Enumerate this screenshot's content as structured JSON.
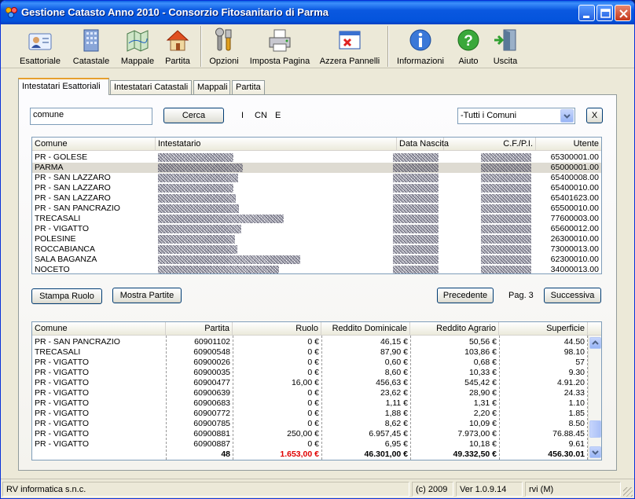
{
  "window": {
    "title": "Gestione Catasto Anno 2010 - Consorzio Fitosanitario di Parma"
  },
  "toolbar": {
    "items": [
      {
        "label": "Esattoriale",
        "icon": "id-card-icon"
      },
      {
        "label": "Catastale",
        "icon": "building-icon"
      },
      {
        "label": "Mappale",
        "icon": "map-icon"
      },
      {
        "label": "Partita",
        "icon": "house-icon"
      },
      {
        "label": "Opzioni",
        "icon": "tools-icon"
      },
      {
        "label": "Imposta Pagina",
        "icon": "printer-icon"
      },
      {
        "label": "Azzera Pannelli",
        "icon": "clear-window-icon"
      },
      {
        "label": "Informazioni",
        "icon": "info-icon"
      },
      {
        "label": "Aiuto",
        "icon": "help-icon"
      },
      {
        "label": "Uscita",
        "icon": "exit-door-icon"
      }
    ]
  },
  "tabs": [
    "Intestatari Esattoriali",
    "Intestatari Catastali",
    "Mappali",
    "Partita"
  ],
  "search": {
    "value": "comune",
    "button": "Cerca",
    "filters": [
      "I",
      "CN",
      "E"
    ],
    "comune_select": "-Tutti i Comuni",
    "clear_button": "X"
  },
  "upper_table": {
    "columns": [
      "Comune",
      "Intestatario",
      "Data Nascita",
      "C.F./P.I.",
      "Utente"
    ],
    "rows": [
      {
        "comune": "PR - GOLESE",
        "utente": "65300001.00"
      },
      {
        "comune": "PARMA",
        "utente": "65000001.00"
      },
      {
        "comune": "PR - SAN LAZZARO",
        "utente": "65400008.00"
      },
      {
        "comune": "PR - SAN LAZZARO",
        "utente": "65400010.00"
      },
      {
        "comune": "PR - SAN LAZZARO",
        "utente": "65401623.00"
      },
      {
        "comune": "PR - SAN PANCRAZIO",
        "utente": "65500010.00"
      },
      {
        "comune": "TRECASALI",
        "utente": "77600003.00"
      },
      {
        "comune": "PR - VIGATTO",
        "utente": "65600012.00"
      },
      {
        "comune": "POLESINE",
        "utente": "26300010.00"
      },
      {
        "comune": "ROCCABIANCA",
        "utente": "73000013.00"
      },
      {
        "comune": "SALA BAGANZA",
        "utente": "62300010.00"
      },
      {
        "comune": "NOCETO",
        "utente": "34000013.00"
      }
    ]
  },
  "actions": {
    "stampa_ruolo": "Stampa Ruolo",
    "mostra_partite": "Mostra Partite",
    "precedente": "Precedente",
    "page": "Pag. 3",
    "successiva": "Successiva"
  },
  "lower_table": {
    "columns": [
      "Comune",
      "Partita",
      "Ruolo",
      "Reddito Dominicale",
      "Reddito Agrario",
      "Superficie"
    ],
    "rows": [
      [
        "PR - SAN PANCRAZIO",
        "60901102",
        "0 €",
        "46,15 €",
        "50,56 €",
        "44.50"
      ],
      [
        "TRECASALI",
        "60900548",
        "0 €",
        "87,90 €",
        "103,86 €",
        "98.10"
      ],
      [
        "PR - VIGATTO",
        "60900026",
        "0 €",
        "0,60 €",
        "0,68 €",
        "57"
      ],
      [
        "PR - VIGATTO",
        "60900035",
        "0 €",
        "8,60 €",
        "10,33 €",
        "9.30"
      ],
      [
        "PR - VIGATTO",
        "60900477",
        "16,00 €",
        "456,63 €",
        "545,42 €",
        "4.91.20"
      ],
      [
        "PR - VIGATTO",
        "60900639",
        "0 €",
        "23,62 €",
        "28,90 €",
        "24.33"
      ],
      [
        "PR - VIGATTO",
        "60900683",
        "0 €",
        "1,11 €",
        "1,31 €",
        "1.10"
      ],
      [
        "PR - VIGATTO",
        "60900772",
        "0 €",
        "1,88 €",
        "2,20 €",
        "1.85"
      ],
      [
        "PR - VIGATTO",
        "60900785",
        "0 €",
        "8,62 €",
        "10,09 €",
        "8.50"
      ],
      [
        "PR - VIGATTO",
        "60900881",
        "250,00 €",
        "6.957,45 €",
        "7.973,00 €",
        "76.88.45"
      ],
      [
        "PR - VIGATTO",
        "60900887",
        "0 €",
        "6,95 €",
        "10,18 €",
        "9.61"
      ]
    ],
    "totals": [
      "",
      "48",
      "1.653,00 €",
      "46.301,00 €",
      "49.332,50 €",
      "456.30.01"
    ],
    "total_ruolo_color": "#e00000"
  },
  "status": {
    "company": "RV informatica s.n.c.",
    "copyright": "(c) 2009",
    "version": "Ver 1.0.9.14",
    "user": "rvi (M)"
  }
}
